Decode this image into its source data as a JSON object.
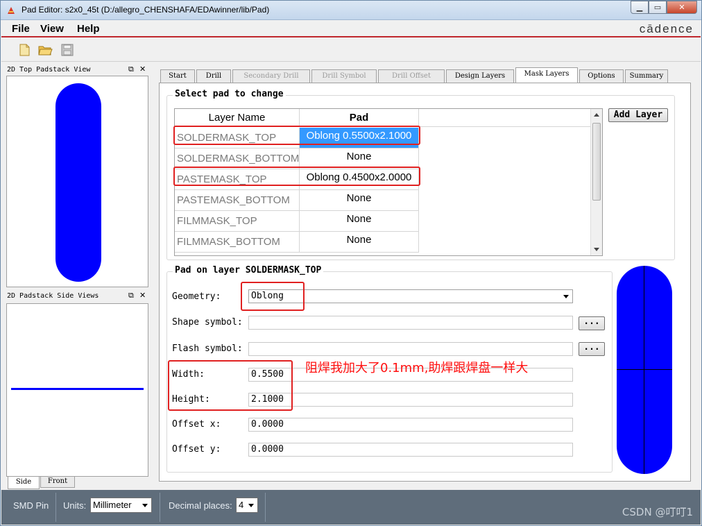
{
  "window": {
    "title": "Pad Editor: s2x0_45t  (D:/allegro_CHENSHAFA/EDAwinner/lib/Pad)",
    "buttons": {
      "minimize": "▁",
      "maximize": "▭",
      "close": "✕"
    }
  },
  "menu": {
    "file": "File",
    "view": "View",
    "help": "Help",
    "brand": "cādence"
  },
  "toolbar": {
    "icons": [
      "new-file-icon",
      "open-folder-icon",
      "save-disk-icon"
    ]
  },
  "left_panels": {
    "top_view_title": "2D Top Padstack View",
    "side_views_title": "2D Padstack Side Views",
    "controls": {
      "float": "⧉",
      "close": "✕"
    },
    "side_tabs": [
      "Side",
      "Front"
    ],
    "pad_color": "#0000ff"
  },
  "tabs": [
    {
      "label": "Start",
      "state": "normal"
    },
    {
      "label": "Drill",
      "state": "normal"
    },
    {
      "label": "Secondary Drill",
      "state": "disabled"
    },
    {
      "label": "Drill Symbol",
      "state": "disabled"
    },
    {
      "label": "Drill Offset",
      "state": "disabled"
    },
    {
      "label": "Design Layers",
      "state": "normal"
    },
    {
      "label": "Mask Layers",
      "state": "active"
    },
    {
      "label": "Options",
      "state": "normal"
    },
    {
      "label": "Summary",
      "state": "normal"
    }
  ],
  "select_pad": {
    "group_label": "Select pad to change",
    "columns": [
      "Layer Name",
      "Pad"
    ],
    "rows": [
      {
        "layer": "SOLDERMASK_TOP",
        "pad": "Oblong 0.5500x2.1000",
        "selected": true
      },
      {
        "layer": "SOLDERMASK_BOTTOM",
        "pad": "None",
        "selected": false
      },
      {
        "layer": "PASTEMASK_TOP",
        "pad": "Oblong 0.4500x2.0000",
        "selected": false
      },
      {
        "layer": "PASTEMASK_BOTTOM",
        "pad": "None",
        "selected": false
      },
      {
        "layer": "FILMMASK_TOP",
        "pad": "None",
        "selected": false
      },
      {
        "layer": "FILMMASK_BOTTOM",
        "pad": "None",
        "selected": false
      }
    ],
    "add_layer_button": "Add Layer"
  },
  "pad_on_layer": {
    "group_label": "Pad on layer SOLDERMASK_TOP",
    "geometry": {
      "label": "Geometry:",
      "value": "Oblong"
    },
    "shape_symbol": {
      "label": "Shape symbol:",
      "value": "",
      "button": "..."
    },
    "flash_symbol": {
      "label": "Flash symbol:",
      "value": "",
      "button": "..."
    },
    "width": {
      "label": "Width:",
      "value": "0.5500"
    },
    "height": {
      "label": "Height:",
      "value": "2.1000"
    },
    "offset_x": {
      "label": "Offset x:",
      "value": "0.0000"
    },
    "offset_y": {
      "label": "Offset y:",
      "value": "0.0000"
    }
  },
  "annotation": "阻焊我加大了0.1mm,助焊跟焊盘一样大",
  "status_bar": {
    "pin_type": "SMD Pin",
    "units_label": "Units:",
    "units_value": "Millimeter",
    "decimal_label": "Decimal places:",
    "decimal_value": "4"
  },
  "watermark": "CSDN @叮叮1",
  "colors": {
    "accent_red": "#c0262c",
    "highlight_box": "#e02020",
    "selection": "#3399ff",
    "pad_fill": "#0000ff"
  }
}
